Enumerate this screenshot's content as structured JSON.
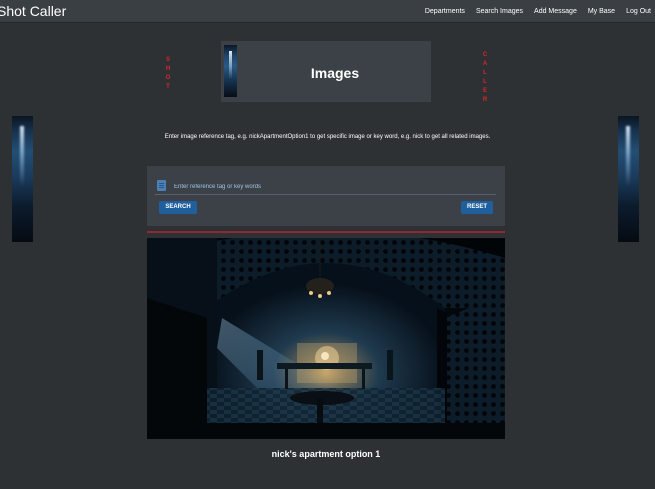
{
  "app": {
    "brand": "Shot Caller"
  },
  "nav": {
    "items": [
      {
        "label": "Departments"
      },
      {
        "label": "Search Images"
      },
      {
        "label": "Add Message"
      },
      {
        "label": "My Base"
      },
      {
        "label": "Log Out"
      }
    ]
  },
  "side_words": {
    "left": [
      "S",
      "H",
      "O",
      "T"
    ],
    "right": [
      "C",
      "A",
      "L",
      "L",
      "E",
      "R"
    ]
  },
  "header": {
    "title": "Images"
  },
  "instructions": "Enter image reference tag, e.g. nickApartmentOption1 to get specific image or key word, e.g. nick to get all related images.",
  "search": {
    "value": "",
    "placeholder": "Enter reference tag or key words",
    "search_label": "SEARCH",
    "reset_label": "RESET"
  },
  "result": {
    "caption": "nick's apartment option 1"
  },
  "colors": {
    "background": "#2e3133",
    "navbar": "#3a3f44",
    "panel": "#3c4147",
    "button": "#1f5f9e",
    "accent_red": "#d9252b"
  }
}
